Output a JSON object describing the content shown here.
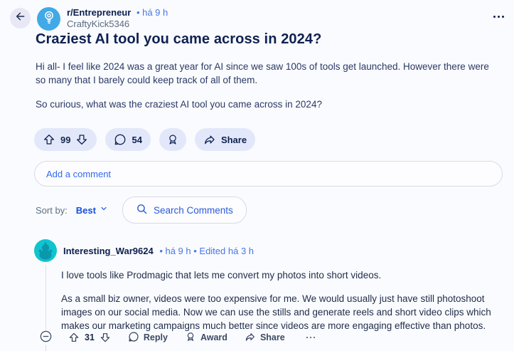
{
  "colors": {
    "page_bg": "#fafbfe",
    "pill_bg": "#e2e8fa",
    "navy": "#0c1f4e",
    "title": "#0e2152",
    "body_text": "#2b3a66",
    "link_blue": "#4677e8",
    "accent_blue": "#2a5bd7",
    "sub_avatar_bg": "#41a9e6",
    "cmt_avatar_bg": "#10c4cf",
    "cmt_avatar_fg": "#0b97ad"
  },
  "header": {
    "subreddit": "r/Entrepreneur",
    "time": "• há 9 h",
    "author": "CraftyKick5346"
  },
  "post": {
    "title": "Craziest AI tool you came across in 2024?",
    "paragraphs": [
      "Hi all- I feel like 2024 was a great year for AI since we saw 100s of tools get launched. However there were so many that I barely could keep track of all of them.",
      "So curious, what was the craziest AI tool you came across in 2024?"
    ],
    "upvotes": "99",
    "comments_count": "54",
    "share_label": "Share"
  },
  "comment_box": {
    "placeholder": "Add a comment"
  },
  "sort": {
    "label": "Sort by:",
    "selected": "Best",
    "search_label": "Search Comments"
  },
  "comments": [
    {
      "author": "Interesting_War9624",
      "meta": "• há 9 h • Edited há 3 h",
      "paragraphs": [
        "I love tools like Prodmagic that lets me convert my photos into short videos.",
        "As a small biz owner, videos were too expensive for me. We would usually just have still photoshoot images on our social media. Now we can use the stills and generate reels and short video clips which makes our marketing campaigns much better since videos are more engaging effective than photos."
      ],
      "votes": "31",
      "reply_label": "Reply",
      "award_label": "Award",
      "share_label": "Share"
    }
  ]
}
